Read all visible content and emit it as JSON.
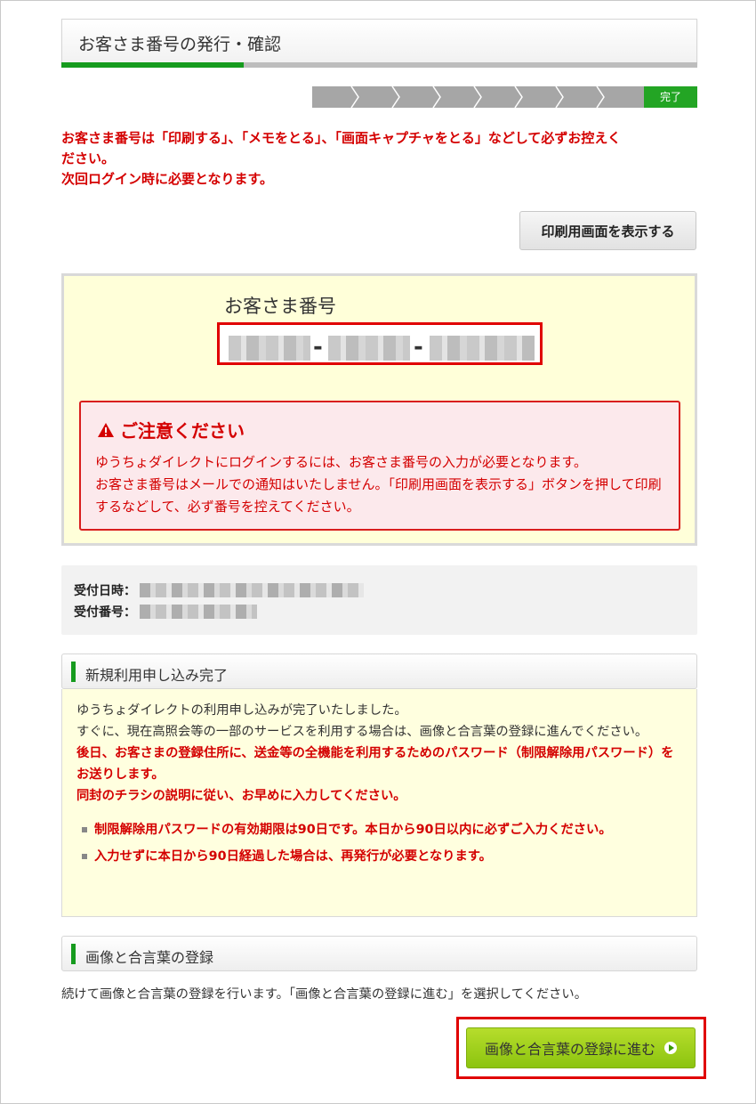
{
  "header": {
    "title": "お客さま番号の発行・確認"
  },
  "steps": {
    "done_label": "完了"
  },
  "top_warning": {
    "line1": "お客さま番号は「印刷する」、「メモをとる」、「画面キャプチャをとる」などして必ずお控えく",
    "line2": "ださい。",
    "line3": "次回ログイン時に必要となります。"
  },
  "print_button": {
    "label": "印刷用画面を表示する"
  },
  "customer_number": {
    "label": "お客さま番号",
    "separator": "-"
  },
  "notice": {
    "title": "ご注意ください",
    "text1": "ゆうちょダイレクトにログインするには、お客さま番号の入力が必要となります。",
    "text2": "お客さま番号はメールでの通知はいたしません。「印刷用画面を表示する」ボタンを押して印刷するなどして、必ず番号を控えてください。"
  },
  "receipt": {
    "date_label": "受付日時：",
    "number_label": "受付番号："
  },
  "section_complete": {
    "heading": "新規利用申し込み完了",
    "p1": "ゆうちょダイレクトの利用申し込みが完了いたしました。",
    "p2": "すぐに、現在高照会等の一部のサービスを利用する場合は、画像と合言葉の登録に進んでください。",
    "p3": "後日、お客さまの登録住所に、送金等の全機能を利用するためのパスワード（制限解除用パスワード）をお送りします。",
    "p4": "同封のチラシの説明に従い、お早めに入力してください。",
    "bullets": [
      "制限解除用パスワードの有効期限は90日です。本日から90日以内に必ずご入力ください。",
      "入力せずに本日から90日経過した場合は、再発行が必要となります。"
    ]
  },
  "section_register": {
    "heading": "画像と合言葉の登録",
    "text": "続けて画像と合言葉の登録を行います。「画像と合言葉の登録に進む」を選択してください。",
    "button": "画像と合言葉の登録に進む"
  },
  "colors": {
    "accent_green": "#169b1e",
    "warning_red": "#d40000",
    "button_green": "#8cc40f"
  }
}
